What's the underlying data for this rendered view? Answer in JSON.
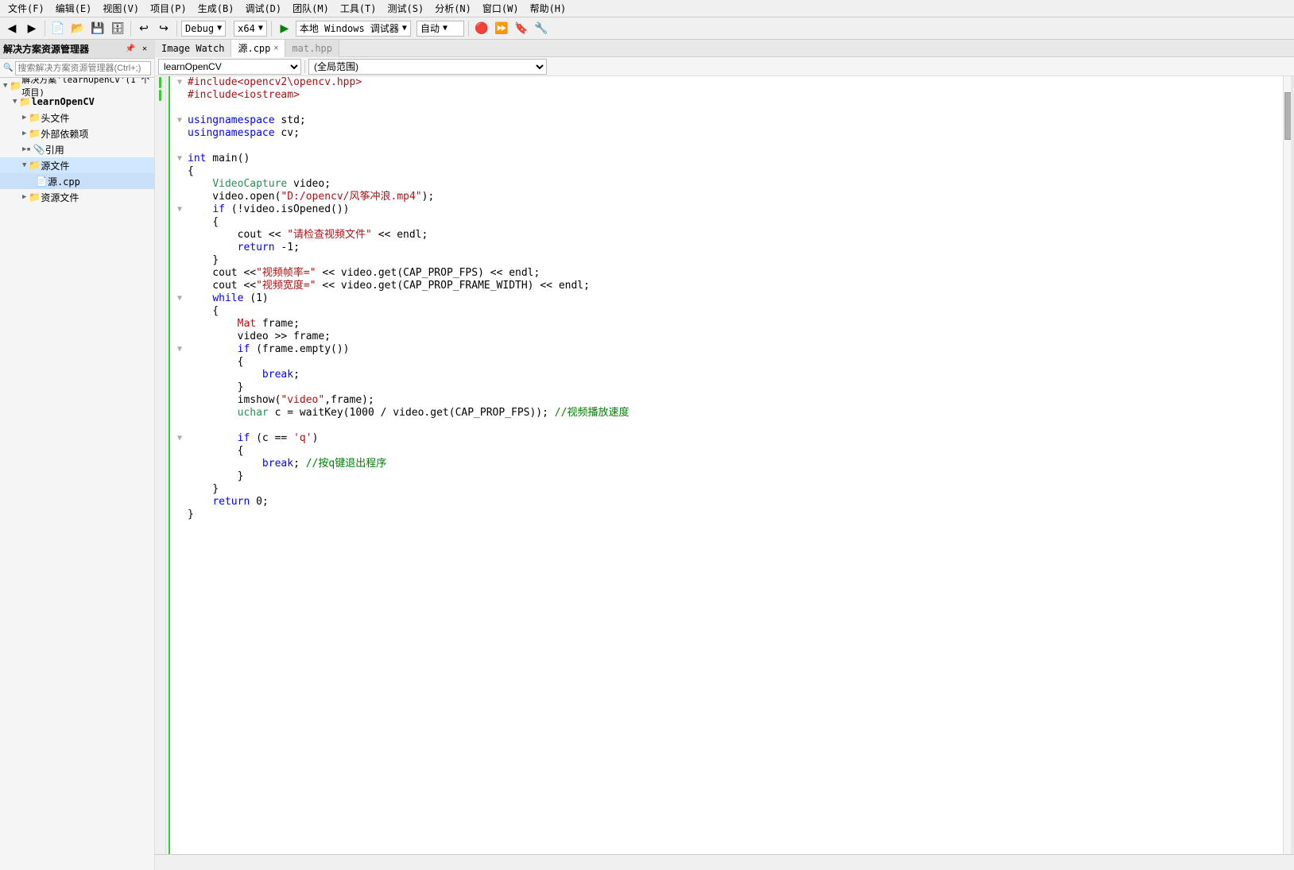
{
  "menu": {
    "items": [
      "文件(F)",
      "编辑(E)",
      "视图(V)",
      "项目(P)",
      "生成(B)",
      "调试(D)",
      "团队(M)",
      "工具(T)",
      "测试(S)",
      "分析(N)",
      "窗口(W)",
      "帮助(H)"
    ]
  },
  "toolbar": {
    "debug_mode": "Debug",
    "platform": "x64",
    "run_label": "本地 Windows 调试器",
    "auto_label": "自动"
  },
  "sidebar": {
    "title": "解决方案资源管理器",
    "search_placeholder": "搜索解决方案资源管理器(Ctrl+;)",
    "solution_label": "解决方案'learnOpenCV'(1 个项目)",
    "project_label": "learnOpenCV",
    "nodes": [
      {
        "label": "头文件",
        "icon": "📁",
        "indent": 2,
        "arrow": "▶"
      },
      {
        "label": "外部依赖项",
        "icon": "📁",
        "indent": 2,
        "arrow": "▶"
      },
      {
        "label": "引用",
        "icon": "📁",
        "indent": 2,
        "arrow": "▶"
      },
      {
        "label": "源文件",
        "icon": "📁",
        "indent": 2,
        "arrow": "▼"
      },
      {
        "label": "源.cpp",
        "icon": "📄",
        "indent": 3,
        "arrow": ""
      },
      {
        "label": "资源文件",
        "icon": "📁",
        "indent": 2,
        "arrow": "▶"
      }
    ]
  },
  "tabs": {
    "imagewatch": "Image Watch",
    "active_file": "源.cpp",
    "other_file": "mat.hpp"
  },
  "code_toolbar": {
    "scope": "learnOpenCV",
    "scope_label": "(全局范围)"
  },
  "code": {
    "lines": [
      {
        "ln": "",
        "fold": "▼",
        "text": "#include<opencv2\\opencv.hpp>",
        "tokens": [
          {
            "t": "#include",
            "c": "inc"
          },
          {
            "t": "<opencv2\\opencv.hpp>",
            "c": "inc"
          }
        ]
      },
      {
        "ln": "",
        "fold": "",
        "text": "#include<iostream>",
        "tokens": [
          {
            "t": "#include",
            "c": "inc"
          },
          {
            "t": "<iostream>",
            "c": "inc"
          }
        ]
      },
      {
        "ln": "",
        "fold": "",
        "text": ""
      },
      {
        "ln": "",
        "fold": "▼",
        "text": "using namespace std;",
        "tokens": [
          {
            "t": "using",
            "c": "kw"
          },
          {
            "t": " namespace ",
            "c": "kw"
          },
          {
            "t": "std",
            "c": ""
          },
          {
            "t": ";",
            "c": ""
          }
        ]
      },
      {
        "ln": "",
        "fold": "",
        "text": "using namespace cv;",
        "tokens": [
          {
            "t": "using",
            "c": "kw"
          },
          {
            "t": " namespace ",
            "c": "kw"
          },
          {
            "t": "cv",
            "c": ""
          },
          {
            "t": ";",
            "c": ""
          }
        ]
      },
      {
        "ln": "",
        "fold": "",
        "text": ""
      },
      {
        "ln": "",
        "fold": "▼",
        "text": "int main()",
        "tokens": [
          {
            "t": "int",
            "c": "kw"
          },
          {
            "t": " main()",
            "c": ""
          }
        ]
      },
      {
        "ln": "",
        "fold": "",
        "text": "{"
      },
      {
        "ln": "",
        "fold": "",
        "text": "    VideoCapture video;",
        "tokens": [
          {
            "t": "    ",
            "c": ""
          },
          {
            "t": "VideoCapture",
            "c": "type"
          },
          {
            "t": " video;",
            "c": ""
          }
        ]
      },
      {
        "ln": "",
        "fold": "",
        "text": "    video.open(\"D:/opencv/风筝冲浪.mp4\");"
      },
      {
        "ln": "",
        "fold": "▼",
        "text": "    if (!video.isOpened())",
        "tokens": [
          {
            "t": "    ",
            "c": ""
          },
          {
            "t": "if",
            "c": "kw"
          },
          {
            "t": " (!video.isOpened())",
            "c": ""
          }
        ]
      },
      {
        "ln": "",
        "fold": "",
        "text": "    {"
      },
      {
        "ln": "",
        "fold": "",
        "text": "        cout << \"请检查视频文件\" << endl;",
        "tokens": [
          {
            "t": "        cout << ",
            "c": ""
          },
          {
            "t": "\"请检查视频文件\"",
            "c": "str"
          },
          {
            "t": " << endl;",
            "c": ""
          }
        ]
      },
      {
        "ln": "",
        "fold": "",
        "text": "        return -1;",
        "tokens": [
          {
            "t": "        ",
            "c": ""
          },
          {
            "t": "return",
            "c": "kw"
          },
          {
            "t": " -1;",
            "c": ""
          }
        ]
      },
      {
        "ln": "",
        "fold": "",
        "text": "    }"
      },
      {
        "ln": "",
        "fold": "",
        "text": "    cout <<\"视频帧率=\" << video.get(CAP_PROP_FPS) << endl;",
        "tokens": [
          {
            "t": "    cout <<",
            "c": ""
          },
          {
            "t": "\"视频帧率=\"",
            "c": "str"
          },
          {
            "t": " << video.get(CAP_PROP_FPS) << endl;",
            "c": ""
          }
        ]
      },
      {
        "ln": "",
        "fold": "",
        "text": "    cout <<\"视频宽度=\" << video.get(CAP_PROP_FRAME_WIDTH) << endl;",
        "tokens": [
          {
            "t": "    cout <<",
            "c": ""
          },
          {
            "t": "\"视频宽度=\"",
            "c": "str"
          },
          {
            "t": " << video.get(CAP_PROP_FRAME_WIDTH) << endl;",
            "c": ""
          }
        ]
      },
      {
        "ln": "",
        "fold": "▼",
        "text": "    while (1)",
        "tokens": [
          {
            "t": "    ",
            "c": ""
          },
          {
            "t": "while",
            "c": "kw"
          },
          {
            "t": " (1)",
            "c": ""
          }
        ]
      },
      {
        "ln": "",
        "fold": "",
        "text": "    {"
      },
      {
        "ln": "",
        "fold": "",
        "text": "        Mat frame;",
        "tokens": [
          {
            "t": "        ",
            "c": ""
          },
          {
            "t": "Mat",
            "c": "red-kw"
          },
          {
            "t": " frame;",
            "c": ""
          }
        ]
      },
      {
        "ln": "",
        "fold": "",
        "text": "        video >> frame;"
      },
      {
        "ln": "",
        "fold": "▼",
        "text": "        if (frame.empty())",
        "tokens": [
          {
            "t": "        ",
            "c": ""
          },
          {
            "t": "if",
            "c": "kw"
          },
          {
            "t": " (frame.empty())",
            "c": ""
          }
        ]
      },
      {
        "ln": "",
        "fold": "",
        "text": "        {"
      },
      {
        "ln": "",
        "fold": "",
        "text": "            break;",
        "tokens": [
          {
            "t": "            ",
            "c": ""
          },
          {
            "t": "break",
            "c": "kw"
          },
          {
            "t": ";",
            "c": ""
          }
        ]
      },
      {
        "ln": "",
        "fold": "",
        "text": "        }"
      },
      {
        "ln": "",
        "fold": "",
        "text": "        imshow(\"video\",frame);",
        "tokens": [
          {
            "t": "        imshow(",
            "c": ""
          },
          {
            "t": "\"video\"",
            "c": "str"
          },
          {
            "t": ",frame);",
            "c": ""
          }
        ]
      },
      {
        "ln": "",
        "fold": "",
        "text": "        uchar c = waitKey(1000 / video.get(CAP_PROP_FPS)); //视频播放速度",
        "tokens": [
          {
            "t": "        ",
            "c": ""
          },
          {
            "t": "uchar",
            "c": "type"
          },
          {
            "t": " c = waitKey(1000 / video.get(CAP_PROP_FPS)); ",
            "c": ""
          },
          {
            "t": "//视频播放速度",
            "c": "cmt"
          }
        ]
      },
      {
        "ln": "",
        "fold": "",
        "text": ""
      },
      {
        "ln": "",
        "fold": "▼",
        "text": "        if (c == 'q')",
        "tokens": [
          {
            "t": "        ",
            "c": ""
          },
          {
            "t": "if",
            "c": "kw"
          },
          {
            "t": " (c == ",
            "c": ""
          },
          {
            "t": "'q'",
            "c": "str"
          },
          {
            "t": ")",
            "c": ""
          }
        ]
      },
      {
        "ln": "",
        "fold": "",
        "text": "        {"
      },
      {
        "ln": "",
        "fold": "",
        "text": "            break; //按q键退出程序",
        "tokens": [
          {
            "t": "            ",
            "c": ""
          },
          {
            "t": "break",
            "c": "kw"
          },
          {
            "t": "; ",
            "c": ""
          },
          {
            "t": "//按q键退出程序",
            "c": "cmt"
          }
        ]
      },
      {
        "ln": "",
        "fold": "",
        "text": "        }"
      },
      {
        "ln": "",
        "fold": "",
        "text": "    }"
      },
      {
        "ln": "",
        "fold": "",
        "text": "    return 0;",
        "tokens": [
          {
            "t": "    ",
            "c": ""
          },
          {
            "t": "return",
            "c": "kw"
          },
          {
            "t": " 0;",
            "c": ""
          }
        ]
      },
      {
        "ln": "",
        "fold": "",
        "text": "}"
      },
      {
        "ln": "",
        "fold": "",
        "text": ""
      }
    ]
  },
  "status": {
    "text": ""
  }
}
